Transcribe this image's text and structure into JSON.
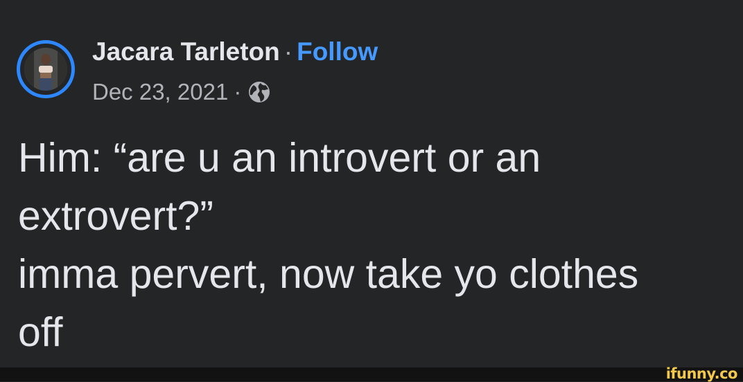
{
  "post": {
    "author": "Jacara Tarleton",
    "separator": "·",
    "follow_label": "Follow",
    "date": "Dec 23, 2021",
    "meta_separator": "·",
    "privacy_icon": "globe-icon",
    "text_lines": [
      "Him: “are u an introvert or an",
      "extrovert?”",
      "imma pervert, now take yo clothes",
      "off"
    ]
  },
  "watermark": "ifunny.co",
  "colors": {
    "background": "#242526",
    "text": "#e4e6eb",
    "secondary_text": "#b0b3b8",
    "accent": "#2d88ff",
    "watermark": "#f2c94c"
  }
}
